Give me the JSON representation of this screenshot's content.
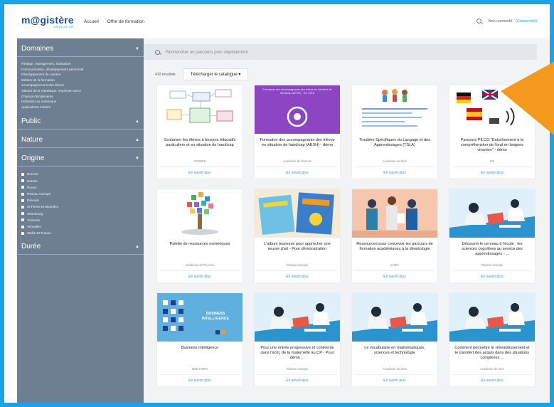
{
  "header": {
    "logo_main": "m@gistère",
    "logo_sub": "EDUCATION",
    "nav": [
      "Accueil",
      "Offre de formation"
    ],
    "status": "Non connecté.",
    "connect": "(Connexion)"
  },
  "sidebar": {
    "domaines_label": "Domaines",
    "domaines": [
      "Pilotage, management, évaluation",
      "Communication, développement personnel",
      "Développement de carrière",
      "Métiers de la formation",
      "Accompagnement des élèves",
      "Valeurs de la république, respecter autrui",
      "Champs disciplinaires",
      "Utilisation du numérique",
      "Applications métiers"
    ],
    "public_label": "Public",
    "nature_label": "Nature",
    "origine_label": "Origine",
    "origines": [
      "Rennes",
      "Nantes",
      "Rouen",
      "Réseau Canopé",
      "Réunion",
      "St-Pierre-Et-Miquelon",
      "Strasbourg",
      "Toulouse",
      "Versailles",
      "Wallis-Et-Futuna"
    ],
    "duree_label": "Durée"
  },
  "main": {
    "search_placeholder": "Rechercher un parcours pour déploiement",
    "results_count": "410 résultats",
    "download_label": "Télécharger le catalogue",
    "link_label": "En savoir plus",
    "cards": [
      {
        "title": "Scolariser les élèves à besoins éducatifs particuliers et en situation de handicap",
        "org": "CNDEEE",
        "thumb": "diagram"
      },
      {
        "title": "Formation des accompagnants des élèves en situation de handicap (AESH) - démo",
        "org": "Académie de Rennes",
        "thumb": "purple",
        "thumb_text": "Formation des accompagnants des élèves en situation de handicap (AESH) - Ed. 2018"
      },
      {
        "title": "Troubles Spécifiques du Langage et des Apprentissages (TSLA)",
        "org": "Académie de Nice",
        "thumb": "kids"
      },
      {
        "title": "Parcours PILCO \"Entraînement à la compréhension de l'oral en langues vivantes\" - démo",
        "org": "IFE",
        "thumb": "flags"
      },
      {
        "title": "Palette de ressources numériques",
        "org": "Académie de Réunion",
        "thumb": "tree"
      },
      {
        "title": "L'album jeunesse pour approcher une œuvre d'art - Pour démonstration",
        "org": "Réseau Canopé",
        "thumb": "books"
      },
      {
        "title": "Ressources pour concevoir les parcours de formation académiques à la déontologie",
        "org": "IH2EF",
        "thumb": "people"
      },
      {
        "title": "Découvrir le cerveau à l'école : les sciences cognitives au service des apprentissages - ...",
        "org": "Réseau Canopé",
        "thumb": "study"
      },
      {
        "title": "Business Intelligence",
        "org": "DNE-FORO",
        "thumb": "bi",
        "thumb_text": "BUSINESS INTELLIGENCE"
      },
      {
        "title": "Pour une entrée progressive et cohérente dans l'écrit, de la maternelle au CP - Pour démo ...",
        "org": "Réseau Canopé",
        "thumb": "study"
      },
      {
        "title": "Le vocabulaire en mathématiques, sciences et technologie",
        "org": "Académie de Nice",
        "thumb": "study"
      },
      {
        "title": "Comment permettre le réinvestissement et le transfert des acquis dans des situations complexes ...",
        "org": "Académie de Nice",
        "thumb": "study"
      }
    ]
  },
  "colors": {
    "frame": "#1aa3e8",
    "sidebar": "#6e7f94",
    "accent": "#1aa3e8",
    "purple": "#8d45c4",
    "arrow": "#f39a1e"
  }
}
